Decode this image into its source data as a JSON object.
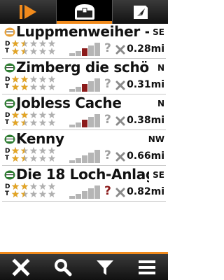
{
  "colors": {
    "accent": "#f08a1c",
    "bar_dark": "#111111",
    "star_on": "#e3a526",
    "star_off": "#b0b0b0",
    "size_active": "#8b1a1a",
    "size_inactive": "#b5b5b5",
    "question_red": "#8b1a1a",
    "question_gray": "#a0a0a0"
  },
  "tabs": [
    {
      "icon": "play-icon"
    },
    {
      "icon": "cache-list-icon",
      "active": true
    },
    {
      "icon": "compass-map-icon"
    }
  ],
  "labels": {
    "difficulty": "D",
    "terrain": "T"
  },
  "caches": [
    {
      "name": "Luppmenweiher -",
      "direction": "SE",
      "distance": "0.28mi",
      "difficulty": 1.5,
      "terrain": 1.5,
      "size_active": 3,
      "icon_color": "#e8a13a",
      "question_color": "gray"
    },
    {
      "name": "Zimberg die schö",
      "direction": "N",
      "distance": "0.31mi",
      "difficulty": 2,
      "terrain": 2,
      "size_active": 3,
      "icon_color": "#2e7d32",
      "question_color": "gray"
    },
    {
      "name": "Jobless Cache",
      "direction": "N",
      "distance": "0.38mi",
      "difficulty": 2,
      "terrain": 1.5,
      "size_active": 3,
      "icon_color": "#2e7d32",
      "question_color": "gray"
    },
    {
      "name": "Kenny",
      "direction": "NW",
      "distance": "0.66mi",
      "difficulty": 1.5,
      "terrain": 1.5,
      "size_active": 0,
      "icon_color": "#2e7d32",
      "question_color": "gray"
    },
    {
      "name": "Die 18 Loch-Anlag",
      "direction": "SE",
      "distance": "0.82mi",
      "difficulty": 2,
      "terrain": 1.5,
      "size_active": 0,
      "icon_color": "#2e7d32",
      "question_color": "red"
    }
  ],
  "question_mark": "?",
  "toolbar": [
    {
      "icon": "close-icon"
    },
    {
      "icon": "search-icon"
    },
    {
      "icon": "filter-icon"
    },
    {
      "icon": "menu-icon"
    }
  ]
}
